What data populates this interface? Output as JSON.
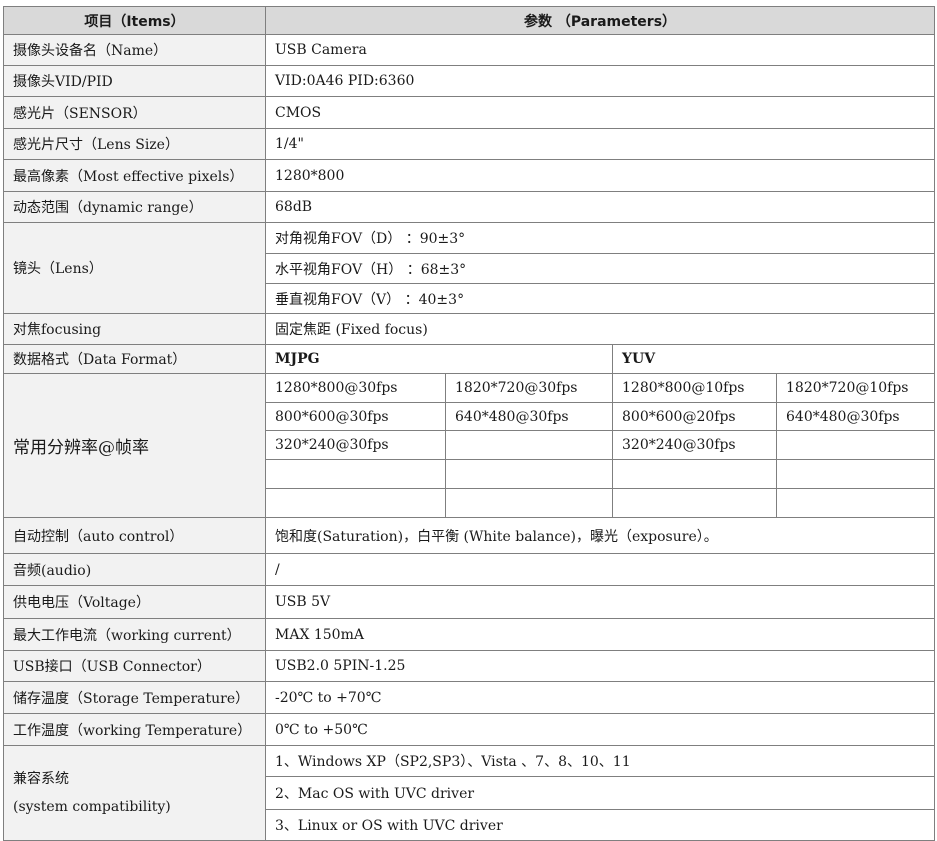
{
  "header": {
    "items": "项目（Items）",
    "parameters": "参数  （Parameters）"
  },
  "rows": {
    "device_name": {
      "label": "摄像头设备名（Name）",
      "value": "USB Camera"
    },
    "vid_pid": {
      "label": "摄像头VID/PID",
      "value": "VID:0A46  PID:6360"
    },
    "sensor": {
      "label": "感光片（SENSOR）",
      "value": "CMOS"
    },
    "lens_size": {
      "label": "感光片尺寸（Lens Size）",
      "value": "1/4\""
    },
    "max_pixels": {
      "label": "最高像素（Most effective pixels）",
      "value": "1280*800"
    },
    "dynamic_range": {
      "label": "动态范围（dynamic  range）",
      "value": "68dB"
    },
    "lens": {
      "label": "镜头（Lens）",
      "values": [
        "对角视角FOV（D） ：90±3°",
        "水平视角FOV（H） ：68±3°",
        "垂直视角FOV（V） ：40±3°"
      ]
    },
    "focusing": {
      "label": "对焦focusing",
      "value": "固定焦距 (Fixed focus)"
    },
    "data_format": {
      "label": "数据格式（Data Format）",
      "mjpg": "MJPG",
      "yuv": "YUV"
    },
    "resolution": {
      "label": "常用分辨率@帧率",
      "grid": [
        [
          "1280*800@30fps",
          "1820*720@30fps",
          "1280*800@10fps",
          "1820*720@10fps"
        ],
        [
          "800*600@30fps",
          "640*480@30fps",
          "800*600@20fps",
          "640*480@30fps"
        ],
        [
          "320*240@30fps",
          "",
          "320*240@30fps",
          ""
        ],
        [
          "",
          "",
          "",
          ""
        ],
        [
          "",
          "",
          "",
          ""
        ]
      ]
    },
    "auto_control": {
      "label": "自动控制（auto control）",
      "value": "饱和度(Saturation)，白平衡 (White balance)，曝光（exposure）。"
    },
    "audio": {
      "label": "音频(audio)",
      "value": "/"
    },
    "voltage": {
      "label": "供电电压（Voltage）",
      "value": "USB 5V"
    },
    "current": {
      "label": "最大工作电流（working current）",
      "value": "MAX 150mA"
    },
    "usb_connector": {
      "label": "USB接口（USB Connector）",
      "value": "USB2.0  5PIN-1.25"
    },
    "storage_temp": {
      "label": "储存温度（Storage Temperature）",
      "value": "-20℃ to +70℃"
    },
    "working_temp": {
      "label": "工作温度（working Temperature）",
      "value": "0℃ to +50℃"
    },
    "compatibility": {
      "label_line1": "兼容系统",
      "label_line2": "(system compatibility)",
      "values": [
        "1、Windows XP（SP2,SP3）、Vista 、7、8、10、11",
        "2、Mac OS with UVC driver",
        "3、Linux or OS with UVC driver"
      ]
    }
  }
}
